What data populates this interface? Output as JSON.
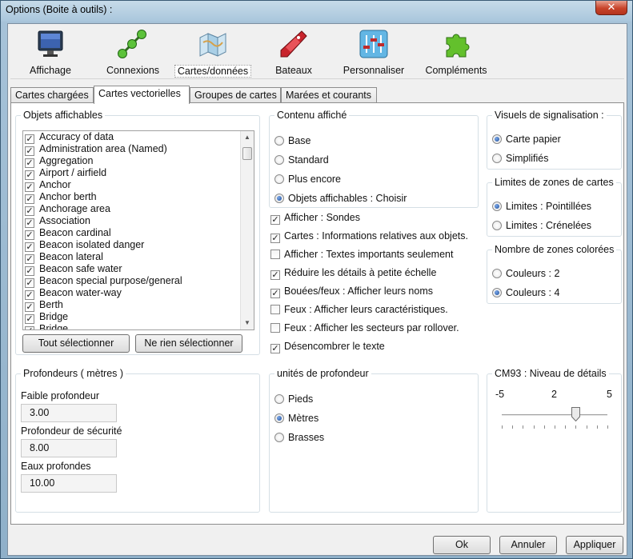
{
  "window": {
    "title": "Options (Boite à outils) :",
    "close_label": "✕"
  },
  "toolbar": {
    "items": [
      {
        "label": "Affichage",
        "icon": "monitor-icon"
      },
      {
        "label": "Connexions",
        "icon": "network-icon"
      },
      {
        "label": "Cartes/données",
        "icon": "charts-icon",
        "active": true
      },
      {
        "label": "Bateaux",
        "icon": "boat-icon"
      },
      {
        "label": "Personnaliser",
        "icon": "sliders-icon"
      },
      {
        "label": "Compléments",
        "icon": "puzzle-icon"
      }
    ]
  },
  "tabs": [
    {
      "label": "Cartes chargées"
    },
    {
      "label": "Cartes vectorielles",
      "active": true
    },
    {
      "label": "Groupes de cartes"
    },
    {
      "label": "Marées et courants"
    }
  ],
  "objets": {
    "legend": "Objets affichables",
    "items": [
      "Accuracy of data",
      "Administration area (Named)",
      "Aggregation",
      "Airport / airfield",
      "Anchor",
      "Anchor berth",
      "Anchorage area",
      "Association",
      "Beacon cardinal",
      "Beacon isolated danger",
      "Beacon lateral",
      "Beacon safe water",
      "Beacon special purpose/general",
      "Beacon water-way",
      "Berth",
      "Bridge",
      "Bridge"
    ],
    "select_all": "Tout sélectionner",
    "select_none": "Ne rien sélectionner"
  },
  "contenu": {
    "legend": "Contenu affiché",
    "radios": [
      {
        "label": "Base",
        "checked": false
      },
      {
        "label": "Standard",
        "checked": false
      },
      {
        "label": "Plus encore",
        "checked": false
      },
      {
        "label": "Objets affichables : Choisir",
        "checked": true
      }
    ],
    "checks": [
      {
        "label": "Afficher : Sondes",
        "checked": true
      },
      {
        "label": "Cartes : Informations relatives aux objets.",
        "checked": true
      },
      {
        "label": "Afficher : Textes importants seulement",
        "checked": false
      },
      {
        "label": "Réduire les détails à petite échelle",
        "checked": true
      },
      {
        "label": "Bouées/feux : Afficher leurs noms",
        "checked": true
      },
      {
        "label": "Feux : Afficher leurs caractéristiques.",
        "checked": false
      },
      {
        "label": "Feux : Afficher les secteurs par rollover.",
        "checked": false
      },
      {
        "label": "Désencombrer le texte",
        "checked": true
      }
    ]
  },
  "visuels": {
    "legend": "Visuels de signalisation :",
    "radios": [
      {
        "label": "Carte papier",
        "checked": true
      },
      {
        "label": "Simplifiés",
        "checked": false
      }
    ]
  },
  "limites": {
    "legend": "Limites de zones de cartes",
    "radios": [
      {
        "label": "Limites : Pointillées",
        "checked": true
      },
      {
        "label": "Limites : Crénelées",
        "checked": false
      }
    ]
  },
  "couleurs": {
    "legend": "Nombre de zones colorées",
    "radios": [
      {
        "label": "Couleurs : 2",
        "checked": false
      },
      {
        "label": "Couleurs : 4",
        "checked": true
      }
    ]
  },
  "profondeurs": {
    "legend": "Profondeurs ( mètres )",
    "faible_label": "Faible profondeur",
    "faible_value": "3.00",
    "securite_label": "Profondeur de sécurité",
    "securite_value": "8.00",
    "eaux_label": "Eaux profondes",
    "eaux_value": "10.00"
  },
  "unites": {
    "legend": "unités de profondeur",
    "radios": [
      {
        "label": "Pieds",
        "checked": false
      },
      {
        "label": "Mètres",
        "checked": true
      },
      {
        "label": "Brasses",
        "checked": false
      }
    ]
  },
  "cm93": {
    "legend": "CM93 : Niveau de détails",
    "min_label": "-5",
    "mid_label": "2",
    "max_label": "5",
    "value": 2,
    "min": -5,
    "max": 5
  },
  "buttons": {
    "ok": "Ok",
    "cancel": "Annuler",
    "apply": "Appliquer"
  },
  "colors": {
    "accent": "#1f4f9a",
    "title_bar": "#a9c6dc",
    "close": "#c7432a"
  }
}
